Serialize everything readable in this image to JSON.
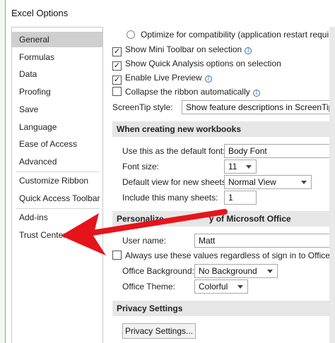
{
  "window": {
    "title": "Excel Options"
  },
  "nav": {
    "items": [
      {
        "label": "General",
        "selected": true
      },
      {
        "label": "Formulas"
      },
      {
        "label": "Data"
      },
      {
        "label": "Proofing"
      },
      {
        "label": "Save"
      },
      {
        "label": "Language"
      },
      {
        "label": "Ease of Access"
      },
      {
        "label": "Advanced"
      },
      {
        "label": "Customize Ribbon"
      },
      {
        "label": "Quick Access Toolbar"
      },
      {
        "label": "Add-ins"
      },
      {
        "label": "Trust Center"
      }
    ]
  },
  "ui_options": {
    "optimize_compat": "Optimize for compatibility (application restart required)",
    "mini_toolbar": "Show Mini Toolbar on selection",
    "quick_analysis": "Show Quick Analysis options on selection",
    "live_preview": "Enable Live Preview",
    "collapse_ribbon": "Collapse the ribbon automatically",
    "screentip_label": "ScreenTip style:",
    "screentip_value": "Show feature descriptions in ScreenTips"
  },
  "new_workbooks": {
    "heading": "When creating new workbooks",
    "default_font_label": "Use this as the default font:",
    "default_font_value": "Body Font",
    "font_size_label": "Font size:",
    "font_size_value": "11",
    "default_view_label": "Default view for new sheets:",
    "default_view_value": "Normal View",
    "sheets_label": "Include this many sheets:",
    "sheets_value": "1"
  },
  "personalize": {
    "heading_left": "Personalize",
    "heading_right": "y of Microsoft Office",
    "username_label": "User name:",
    "username_value": "Matt",
    "always_use": "Always use these values regardless of sign in to Office.",
    "background_label": "Office Background:",
    "background_value": "No Background",
    "theme_label": "Office Theme:",
    "theme_value": "Colorful"
  },
  "privacy": {
    "heading": "Privacy Settings",
    "button": "Privacy Settings..."
  },
  "colors": {
    "arrow": "#e5141b",
    "selected_nav": "#cfcfcf"
  }
}
